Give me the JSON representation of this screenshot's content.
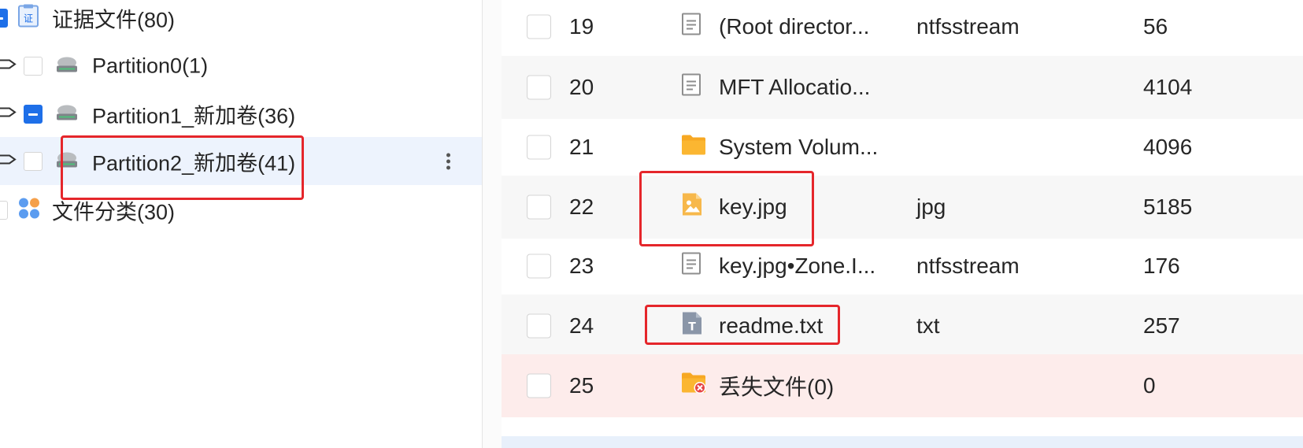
{
  "tree": {
    "items": [
      {
        "label": "证据文件(80)",
        "icon": "evidence-icon",
        "checkbox": "partial",
        "caret": false,
        "selected": false
      },
      {
        "label": "Partition0(1)",
        "icon": "disk-icon",
        "checkbox": "unchecked",
        "caret": true,
        "selected": false
      },
      {
        "label": "Partition1_新加卷(36)",
        "icon": "disk-icon",
        "checkbox": "partial",
        "caret": true,
        "selected": false
      },
      {
        "label": "Partition2_新加卷(41)",
        "icon": "disk-icon",
        "checkbox": "unchecked",
        "caret": true,
        "selected": true
      },
      {
        "label": "文件分类(30)",
        "icon": "category-icon",
        "checkbox": "unchecked",
        "caret": false,
        "selected": false
      }
    ],
    "more_icon": "more-vertical-icon"
  },
  "files": {
    "rows": [
      {
        "num": "19",
        "name": "(Root director...",
        "type": "ntfsstream",
        "size": "56",
        "icon": "document-icon"
      },
      {
        "num": "20",
        "name": "MFT Allocatio...",
        "type": "",
        "size": "4104",
        "icon": "document-icon"
      },
      {
        "num": "21",
        "name": "System Volum...",
        "type": "",
        "size": "4096",
        "icon": "folder-icon"
      },
      {
        "num": "22",
        "name": "key.jpg",
        "type": "jpg",
        "size": "5185",
        "icon": "image-file-icon"
      },
      {
        "num": "23",
        "name": "key.jpg•Zone.I...",
        "type": "ntfsstream",
        "size": "176",
        "icon": "document-icon"
      },
      {
        "num": "24",
        "name": "readme.txt",
        "type": "txt",
        "size": "257",
        "icon": "text-file-icon"
      },
      {
        "num": "25",
        "name": "丢失文件(0)",
        "type": "",
        "size": "0",
        "icon": "lost-folder-icon"
      }
    ]
  },
  "colors": {
    "accent": "#1e6fe8",
    "selected_row": "#edf3fd",
    "lost_row": "#fdeceb",
    "annotation": "#e5262b",
    "folder": "#f7a823"
  }
}
